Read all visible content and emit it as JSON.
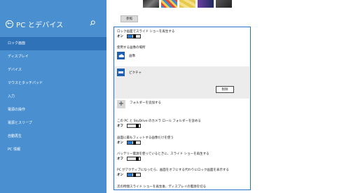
{
  "sidebar": {
    "title": "PC とデバイス",
    "items": [
      {
        "label": "ロック画面",
        "active": true
      },
      {
        "label": "ディスプレイ",
        "active": false
      },
      {
        "label": "デバイス",
        "active": false
      },
      {
        "label": "マウスとタッチパッド",
        "active": false
      },
      {
        "label": "入力",
        "active": false
      },
      {
        "label": "電源の操作",
        "active": false
      },
      {
        "label": "電源とスリープ",
        "active": false
      },
      {
        "label": "自動再生",
        "active": false
      },
      {
        "label": "PC 情報",
        "active": false
      }
    ]
  },
  "main": {
    "browse_button": "参照",
    "thumbnail_colors": [
      "#3a3a3a",
      "#e8c94a",
      "#6a3fa0",
      "#1e2a5e",
      "#555555"
    ],
    "slideshow": {
      "label": "ロック画面でスライド ショーを再生する",
      "state": "オン",
      "on": true
    },
    "sources_heading": "使用する画像の場所",
    "sources": [
      {
        "name": "画像",
        "icon": "cloud-icon"
      },
      {
        "name": "ピクチャ",
        "icon": "folder-icon"
      }
    ],
    "remove_button": "削除",
    "add_folder": "フォルダーを追加する",
    "settings": [
      {
        "label": "この PC と SkyDrive のカメラ ロール フォルダーを含める",
        "state": "オフ",
        "on": false
      },
      {
        "label": "画面に最もフィットする画像だけを使う",
        "state": "オン",
        "on": true
      },
      {
        "label": "バッテリー電源を使っているときに、スライド ショーを再生する",
        "state": "オフ",
        "on": false
      },
      {
        "label": "PC がアクティブになったら、画面をオフにする代わりにロック画面を表示する",
        "state": "オン",
        "on": true
      }
    ],
    "footer_text": "次の時間スライド ショーを再生後、ディスプレイの電源を切る"
  }
}
